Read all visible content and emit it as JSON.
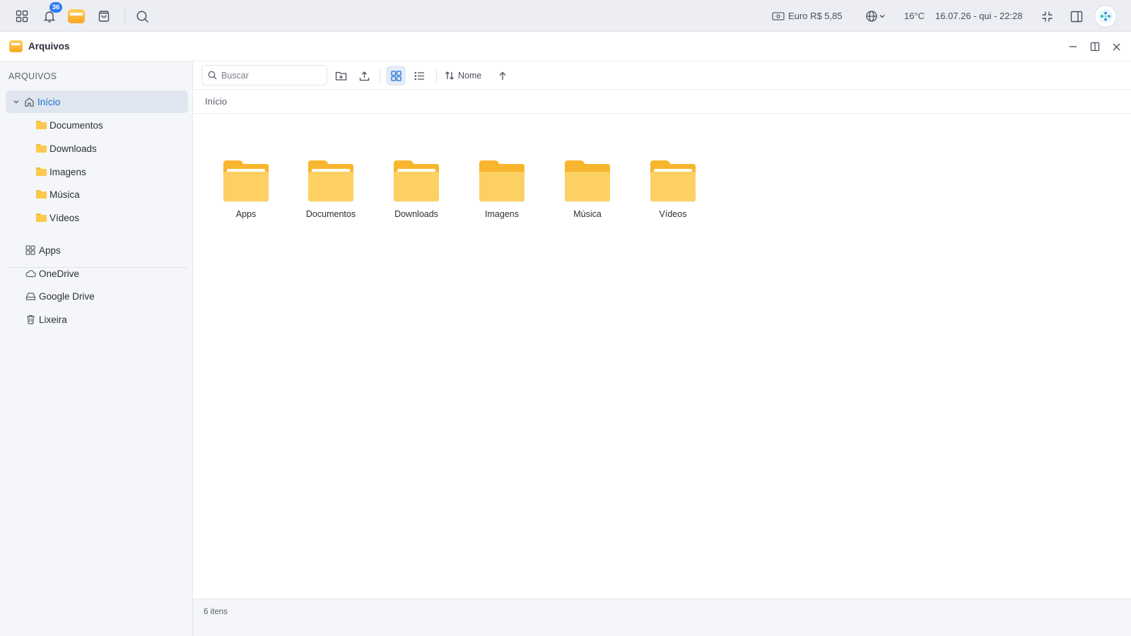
{
  "taskbar": {
    "notification_count": "36",
    "currency": "Euro R$ 5,85",
    "temperature": "16°C",
    "datetime": "16.07.26 - qui - 22:28"
  },
  "window": {
    "title": "Arquivos"
  },
  "sidebar": {
    "heading": "ARQUIVOS",
    "home": "Início",
    "folders": [
      "Documentos",
      "Downloads",
      "Imagens",
      "Música",
      "Vídeos"
    ],
    "locations": [
      "Apps",
      "OneDrive",
      "Google Drive",
      "Lixeira"
    ]
  },
  "toolbar": {
    "search_placeholder": "Buscar",
    "sort_label": "Nome"
  },
  "breadcrumb": "Início",
  "files": [
    "Apps",
    "Documentos",
    "Downloads",
    "Imagens",
    "Música",
    "Vídeos"
  ],
  "status": "6 itens",
  "colors": {
    "accent": "#1f6fd1",
    "folder": "#fdd064",
    "badge": "#2f7cf6"
  }
}
